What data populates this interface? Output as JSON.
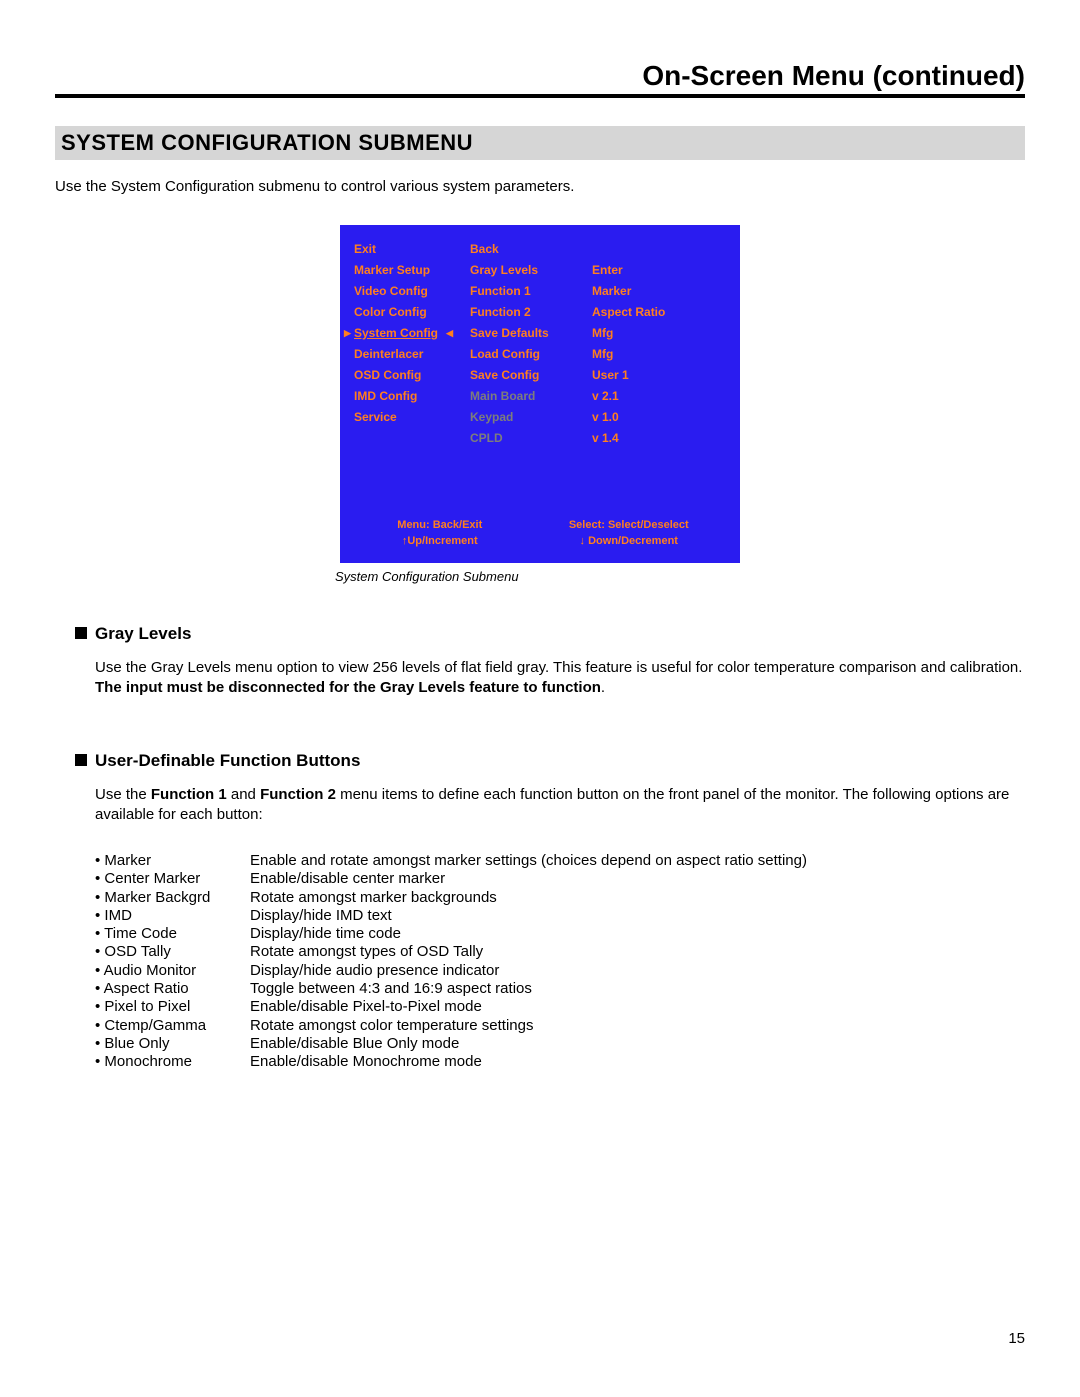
{
  "header": {
    "title": "On-Screen Menu (continued)"
  },
  "section": {
    "title": "SYSTEM CONFIGURATION SUBMENU"
  },
  "intro": "Use the System Configuration submenu to control various system parameters.",
  "osd": {
    "col1": [
      {
        "text": "Exit",
        "dim": false,
        "selected": false
      },
      {
        "text": "Marker Setup",
        "dim": false,
        "selected": false
      },
      {
        "text": "Video Config",
        "dim": false,
        "selected": false
      },
      {
        "text": "Color Config",
        "dim": false,
        "selected": false
      },
      {
        "text": "System Config",
        "dim": false,
        "selected": true
      },
      {
        "text": "Deinterlacer",
        "dim": false,
        "selected": false
      },
      {
        "text": "OSD Config",
        "dim": false,
        "selected": false
      },
      {
        "text": "IMD Config",
        "dim": false,
        "selected": false
      },
      {
        "text": "Service",
        "dim": false,
        "selected": false
      }
    ],
    "col2": [
      {
        "text": "Back",
        "dim": false
      },
      {
        "text": "Gray Levels",
        "dim": false
      },
      {
        "text": "Function 1",
        "dim": false
      },
      {
        "text": "Function 2",
        "dim": false
      },
      {
        "text": "Save Defaults",
        "dim": false
      },
      {
        "text": "Load Config",
        "dim": false
      },
      {
        "text": "Save Config",
        "dim": false
      },
      {
        "text": "Main Board",
        "dim": true
      },
      {
        "text": "Keypad",
        "dim": true
      },
      {
        "text": "CPLD",
        "dim": true
      }
    ],
    "col3": [
      {
        "text": "",
        "dim": false
      },
      {
        "text": "Enter",
        "dim": false
      },
      {
        "text": "Marker",
        "dim": false
      },
      {
        "text": "Aspect Ratio",
        "dim": false
      },
      {
        "text": "Mfg",
        "dim": false
      },
      {
        "text": "Mfg",
        "dim": false
      },
      {
        "text": "User 1",
        "dim": false
      },
      {
        "text": "v 2.1",
        "dim": false
      },
      {
        "text": "v 1.0",
        "dim": false
      },
      {
        "text": "v 1.4",
        "dim": false
      }
    ],
    "footer": {
      "left1": "Menu: Back/Exit",
      "left2": "↑Up/Increment",
      "right1": "Select: Select/Deselect",
      "right2": "↓ Down/Decrement"
    },
    "caption": "System Configuration Submenu"
  },
  "gray": {
    "heading": "Gray Levels",
    "body_pre": "Use the Gray Levels menu option to view 256 levels of flat field gray. This feature is useful for color temperature comparison and calibration. ",
    "body_bold": "The input must be disconnected for the Gray Levels feature to function",
    "body_post": "."
  },
  "func": {
    "heading": "User-Definable Function Buttons",
    "para_1": "Use the ",
    "para_b1": "Function 1",
    "para_2": " and ",
    "para_b2": "Function 2",
    "para_3": " menu items to define each function button on the front panel of the monitor. The following options are available for each button:",
    "options": [
      {
        "name": "Marker",
        "desc": "Enable and rotate amongst marker settings (choices depend on aspect ratio setting)"
      },
      {
        "name": "Center Marker",
        "desc": "Enable/disable center marker"
      },
      {
        "name": "Marker Backgrd",
        "desc": "Rotate amongst marker backgrounds"
      },
      {
        "name": "IMD",
        "desc": "Display/hide IMD text"
      },
      {
        "name": "Time Code",
        "desc": "Display/hide time code"
      },
      {
        "name": "OSD Tally",
        "desc": "Rotate amongst types of OSD Tally"
      },
      {
        "name": "Audio Monitor",
        "desc": "Display/hide audio presence indicator"
      },
      {
        "name": "Aspect Ratio",
        "desc": "Toggle between 4:3 and 16:9 aspect ratios"
      },
      {
        "name": "Pixel to Pixel",
        "desc": "Enable/disable Pixel-to-Pixel mode"
      },
      {
        "name": "Ctemp/Gamma",
        "desc": "Rotate amongst color temperature settings"
      },
      {
        "name": "Blue Only",
        "desc": "Enable/disable Blue Only mode"
      },
      {
        "name": "Monochrome",
        "desc": "Enable/disable Monochrome mode"
      }
    ]
  },
  "page": "15"
}
